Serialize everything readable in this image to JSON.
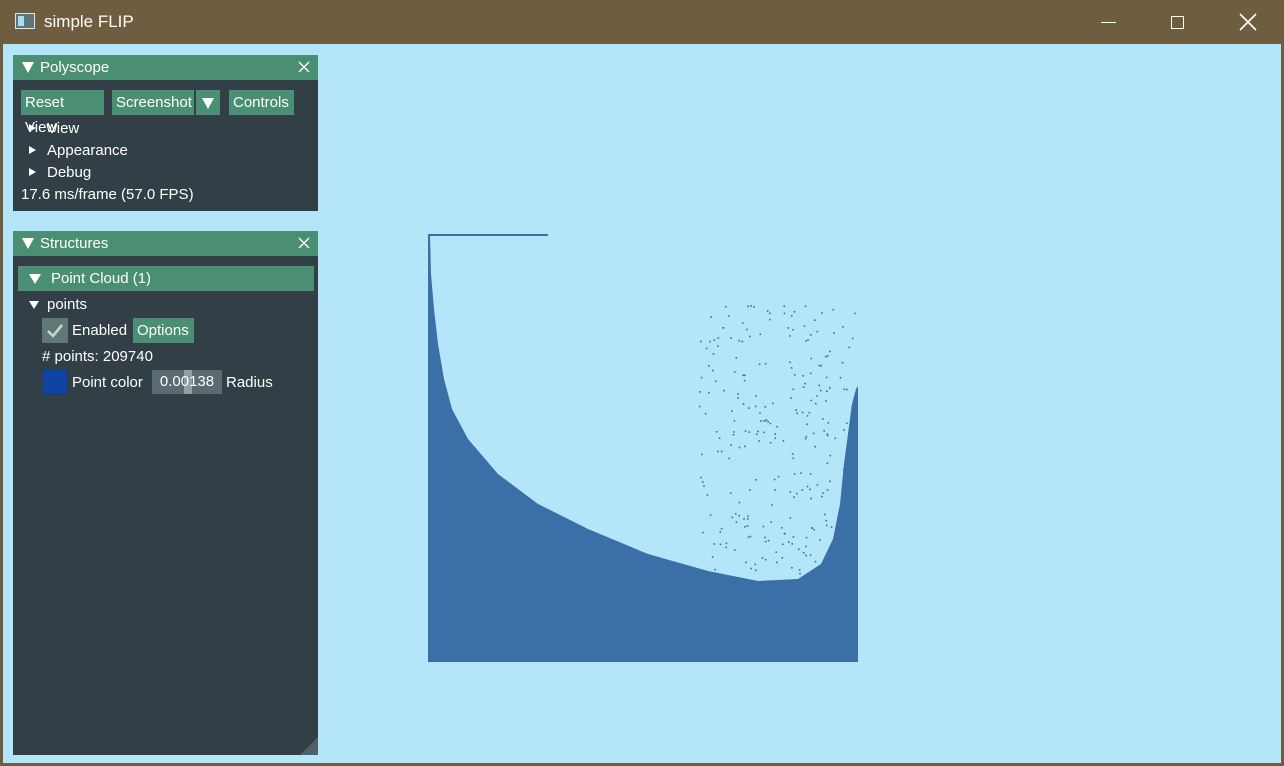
{
  "window": {
    "title": "simple FLIP",
    "icons": {
      "app": "app-window-icon",
      "minimize": "minimize-icon",
      "maximize": "maximize-icon",
      "close": "close-icon"
    }
  },
  "polyscope_panel": {
    "title": "Polyscope",
    "buttons": {
      "reset_view": "Reset View",
      "screenshot": "Screenshot",
      "controls": "Controls"
    },
    "tree_items": [
      "View",
      "Appearance",
      "Debug"
    ],
    "fps_text": "17.6 ms/frame (57.0 FPS)"
  },
  "structures_panel": {
    "title": "Structures",
    "point_cloud_header": "Point Cloud (1)",
    "points_node": "points",
    "enabled_label": "Enabled",
    "enabled_checked": true,
    "options_button": "Options",
    "points_count_text": "# points: 209740",
    "point_color_label": "Point color",
    "point_color": "#0f44a3",
    "radius_value": "0.00138",
    "radius_label": "Radius"
  },
  "colors": {
    "titlebar": "#6e5d3f",
    "viewport_bg": "#b5e5f8",
    "panel_bg": "#323f47",
    "accent_green": "#4a8f74",
    "fluid": "#3a6fa8"
  }
}
